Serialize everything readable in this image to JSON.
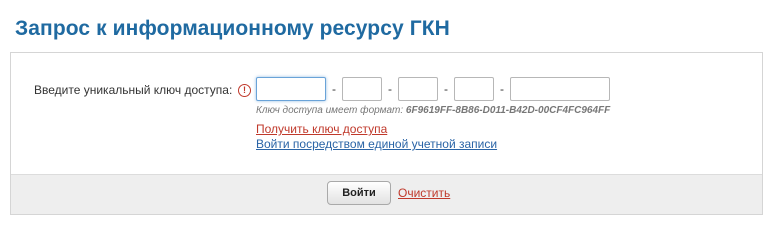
{
  "page": {
    "title": "Запрос к информационному ресурсу ГКН"
  },
  "form": {
    "key_label": "Введите уникальный ключ доступа:",
    "info_icon": "info-icon",
    "separator": "-",
    "key_parts": [
      "",
      "",
      "",
      "",
      ""
    ],
    "format_hint_prefix": "Ключ доступа имеет формат:",
    "format_hint_example": "6F9619FF-8B86-D011-B42D-00CF4FC964FF",
    "get_key_link": "Получить ключ доступа",
    "login_link": "Войти посредством единой учетной записи"
  },
  "footer": {
    "submit_label": "Войти",
    "clear_label": "Очистить"
  },
  "colors": {
    "title": "#1f6aa1",
    "link_red": "#c0392b",
    "link_blue": "#2a64a6",
    "footer_bg": "#eeeeee"
  }
}
